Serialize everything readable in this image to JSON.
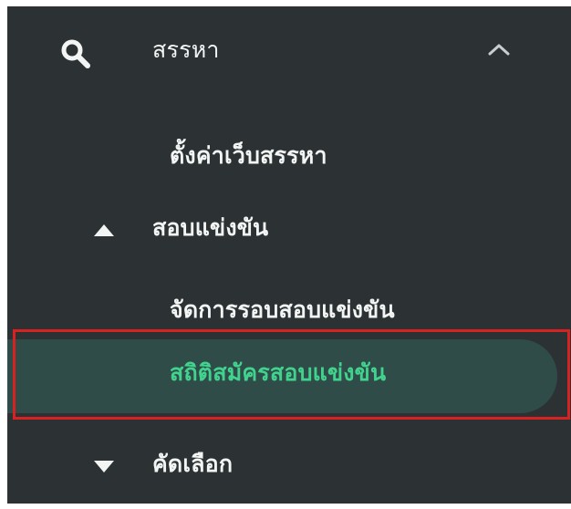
{
  "menu": {
    "search_section": {
      "label": "สรรหา",
      "icon": "search-icon",
      "toggle_icon": "chevron-up-icon"
    },
    "items": {
      "website_settings": {
        "label": "ตั้งค่าเว็บสรรหา"
      },
      "competition_exam": {
        "label": "สอบแข่งขัน",
        "icon": "triangle-up-icon"
      },
      "manage_exam_rounds": {
        "label": "จัดการรอบสอบแข่งขัน"
      },
      "exam_application_stats": {
        "label": "สถิติสมัครสอบแข่งขัน",
        "selected": true
      },
      "selection": {
        "label": "คัดเลือก",
        "icon": "triangle-down-icon"
      }
    }
  },
  "colors": {
    "panel_background": "#2c3233",
    "active_background": "#2f4c49",
    "active_text": "#41d38e",
    "default_text": "#f3f5f5",
    "highlight_border": "#d82121"
  }
}
